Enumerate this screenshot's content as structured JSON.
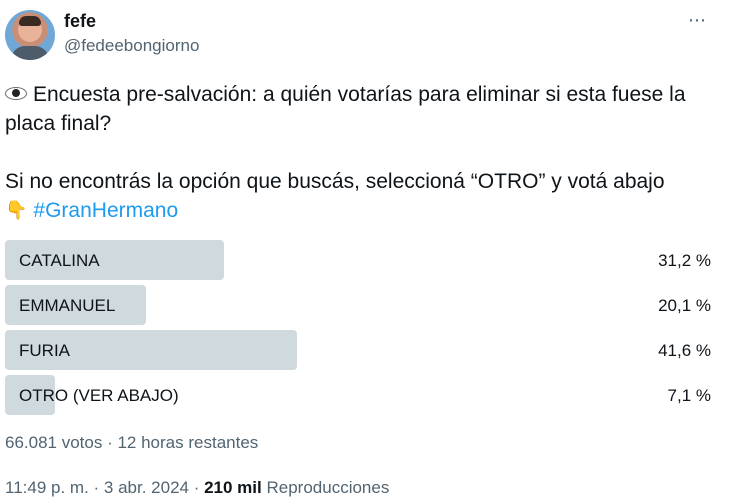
{
  "author": {
    "name": "fefe",
    "handle": "@fedeebongiorno"
  },
  "more_icon": "more-options-icon",
  "tweet": {
    "line1_icon": "eye-emoji",
    "line1": "Encuesta pre-salvación: a quién votarías para eliminar si esta fuese la placa final?",
    "line2": "Si no encontrás la opción que buscás, seleccioná “OTRO” y votá abajo",
    "line3_icon": "pointing-down-emoji",
    "hashtag": "#GranHermano"
  },
  "poll": {
    "options": [
      {
        "label": "CATALINA",
        "percent_text": "31,2 %",
        "share": 0.312
      },
      {
        "label": "EMMANUEL",
        "percent_text": "20,1 %",
        "share": 0.201
      },
      {
        "label": "FURIA",
        "percent_text": "41,6 %",
        "share": 0.416
      },
      {
        "label": "OTRO (VER ABAJO)",
        "percent_text": "7,1 %",
        "share": 0.071
      }
    ],
    "votes": "66.081 votos",
    "separator": " · ",
    "time_left": "12 horas restantes"
  },
  "footer": {
    "time": "11:49 p. m.",
    "separator": " · ",
    "date": "3 abr. 2024",
    "views_count": "210 mil",
    "views_label": "Reproducciones"
  },
  "colors": {
    "bar": "#cfd9de",
    "hashtag": "#1d9bf0",
    "secondary_text": "#536471"
  }
}
